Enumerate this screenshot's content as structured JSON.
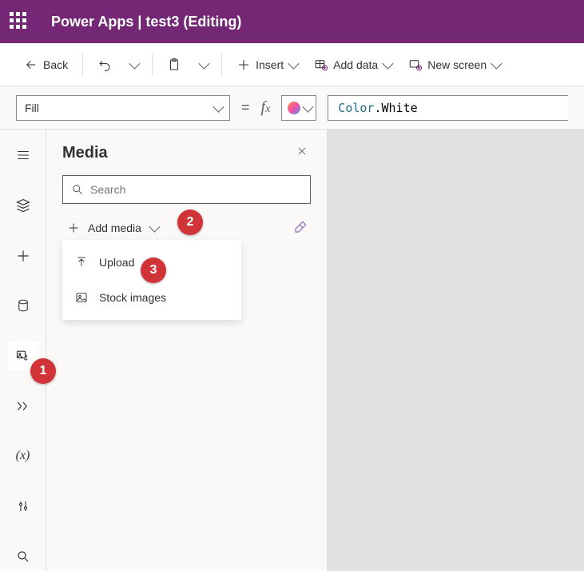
{
  "header": {
    "app_name": "Power Apps",
    "separator": "  |  ",
    "file_name": "test3 (Editing)"
  },
  "cmdbar": {
    "back": "Back",
    "insert": "Insert",
    "add_data": "Add data",
    "new_screen": "New screen"
  },
  "formula": {
    "property": "Fill",
    "expr_type": "Color",
    "expr_dot": ".",
    "expr_value": "White"
  },
  "panel": {
    "title": "Media",
    "search_placeholder": "Search",
    "add_media": "Add media"
  },
  "dropdown": {
    "upload": "Upload",
    "stock": "Stock images"
  },
  "annotations": {
    "a1": "1",
    "a2": "2",
    "a3": "3"
  }
}
